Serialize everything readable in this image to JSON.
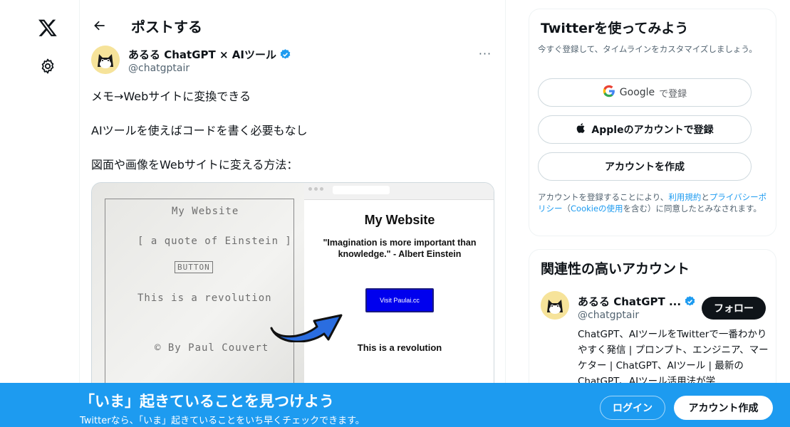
{
  "nav": {
    "logo_icon": "x-logo-icon",
    "settings_icon": "gear-icon"
  },
  "header": {
    "title": "ポストする",
    "back_icon": "arrow-left-icon"
  },
  "post": {
    "author_name": "あるる ChatGPT × AIツール",
    "author_handle": "@chatgptair",
    "more_label": "···",
    "text": [
      "メモ→Webサイトに変換できる",
      "AIツールを使えばコードを書く必要もなし",
      "図面や画像をWebサイトに変える方法："
    ],
    "media": {
      "sketch": {
        "title": "My Website",
        "quote": "[ a quote of Einstein ]",
        "button": "BUTTON",
        "line": "This is a revolution",
        "signature": "© By Paul Couvert"
      },
      "site": {
        "title": "My Website",
        "quote": "\"Imagination is more important than knowledge.\" - Albert Einstein",
        "button": "Visit Paulai.cc",
        "line": "This is a revolution"
      }
    }
  },
  "signup_card": {
    "title": "Twitterを使ってみよう",
    "subtitle": "今すぐ登録して、タイムラインをカスタマイズしましょう。",
    "google_label": "Google",
    "google_suffix": "で登録",
    "apple_label": "Appleのアカウントで登録",
    "create_label": "アカウントを作成",
    "terms_prefix": "アカウントを登録することにより、",
    "terms_link": "利用規約",
    "terms_and": "と",
    "privacy_link": "プライバシーポリシー",
    "paren_open": "（",
    "cookie_link": "Cookieの使用",
    "terms_suffix": "を含む）に同意したとみなされます。"
  },
  "related_card": {
    "title": "関連性の高いアカウント",
    "name": "あるる ChatGPT ...",
    "handle": "@chatgptair",
    "follow_label": "フォロー",
    "bio": "ChatGPT、AIツールをTwitterで一番わかりやすく発信 | プロンプト、エンジニア、マーケター | ChatGPT、AIツール | 最新のChatGPT、AIツール活用法が学"
  },
  "banner": {
    "title": "「いま」起きていることを見つけよう",
    "subtitle": "Twitterなら、「いま」起きていることをいち早くチェックできます。",
    "login_label": "ログイン",
    "signup_label": "アカウント作成"
  },
  "colors": {
    "accent": "#1d9bf0",
    "text": "#0f1419",
    "secondary": "#536471"
  }
}
